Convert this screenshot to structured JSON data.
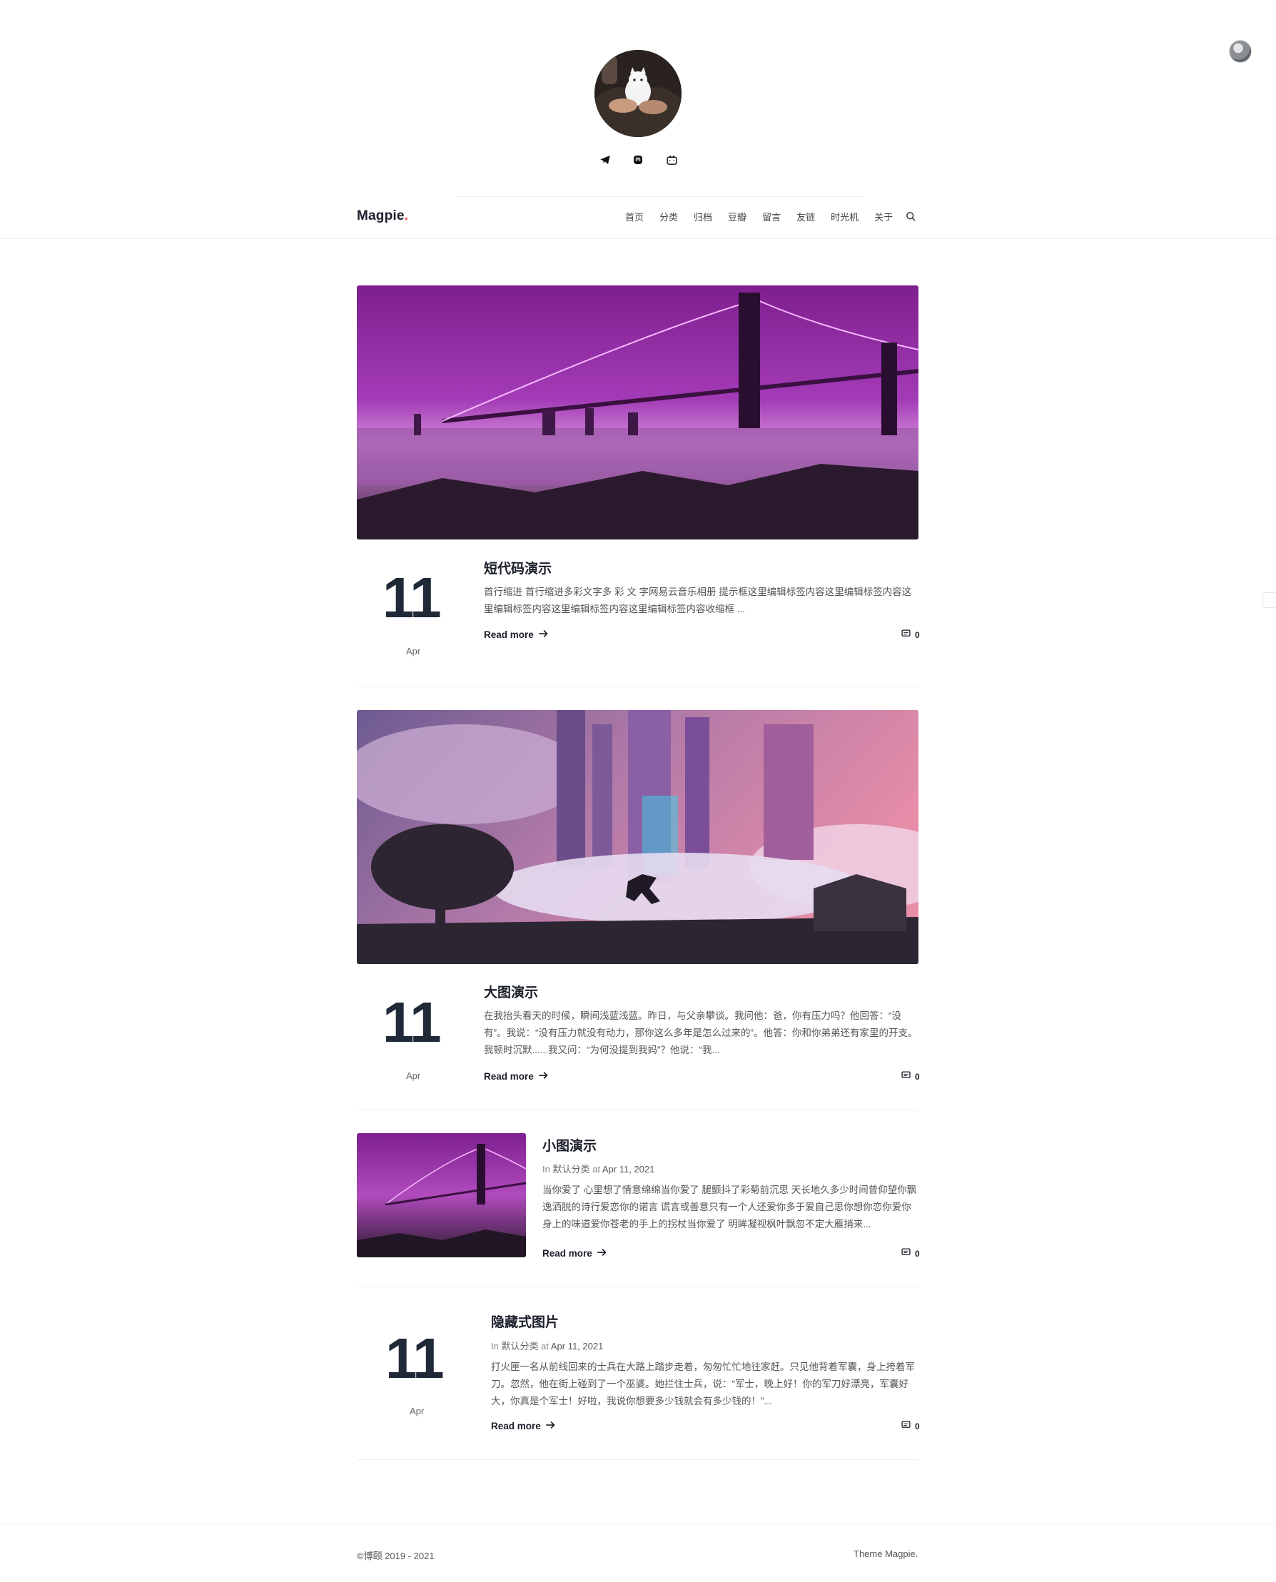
{
  "site": {
    "brand": "Magpie",
    "brand_dot": ".",
    "brand_dot_color": "#ff3b3b",
    "accent_text": "#1b1f29"
  },
  "header": {
    "social_icons": [
      "telegram-icon",
      "mastodon-icon",
      "bilibili-icon"
    ]
  },
  "nav": {
    "items": [
      "首页",
      "分类",
      "归档",
      "豆瓣",
      "留言",
      "友链",
      "时光机",
      "关于"
    ],
    "search_icon": "search-icon"
  },
  "posts": [
    {
      "title": "短代码演示",
      "day": "11",
      "month": "Apr",
      "excerpt": "首行缩进        首行缩进多彩文字多 彩 文 字网易云音乐相册 提示框这里编辑标签内容这里编辑标签内容这里编辑标签内容这里编辑标签内容这里编辑标签内容收缩框 ...",
      "read_more": "Read more",
      "comments": "0"
    },
    {
      "title": "大图演示",
      "day": "11",
      "month": "Apr",
      "excerpt": "在我抬头看天的时候，瞬间浅蓝浅蓝。昨日，与父亲攀谈。我问他：爸，你有压力吗？他回答：“没有”。我说：“没有压力就没有动力，那你这么多年是怎么过来的”。他答：你和你弟弟还有家里的开支。我顿时沉默......我又问：“为何没提到我妈”？他说：“我...",
      "read_more": "Read more",
      "comments": "0"
    },
    {
      "title": "小图演示",
      "meta_in": "In",
      "category": "默认分类",
      "meta_at": "at",
      "date": "Apr 11, 2021",
      "excerpt": "当你爱了 心里想了情意绵绵当你爱了 腿颤抖了彩菊前沉思 天长地久多少时间曾仰望你飘逸洒脱的诗行爱恋你的诺言 谎言或善意只有一个人还爱你多于爱自己思你想你恋你爱你身上的味道爱你苍老的手上的拐杖当你爱了 明眸凝视枫叶飘忽不定大雁捎来...",
      "read_more": "Read more",
      "comments": "0"
    },
    {
      "title": "隐藏式图片",
      "day": "11",
      "month": "Apr",
      "meta_in": "In",
      "category": "默认分类",
      "meta_at": "at",
      "date": "Apr 11, 2021",
      "excerpt": "打火匣一名从前线回来的士兵在大路上踏步走着，匆匆忙忙地往家赶。只见他背着军囊，身上挎着军刀。忽然，他在街上碰到了一个巫婆。她拦住士兵，说：“军士，晚上好！你的军刀好漂亮，军囊好大，你真是个军士！好啦，我说你想要多少钱就会有多少钱的！”...",
      "read_more": "Read more",
      "comments": "0"
    }
  ],
  "footer": {
    "copyright": "©博颐 2019 - 2021",
    "theme": "Theme Magpie."
  }
}
